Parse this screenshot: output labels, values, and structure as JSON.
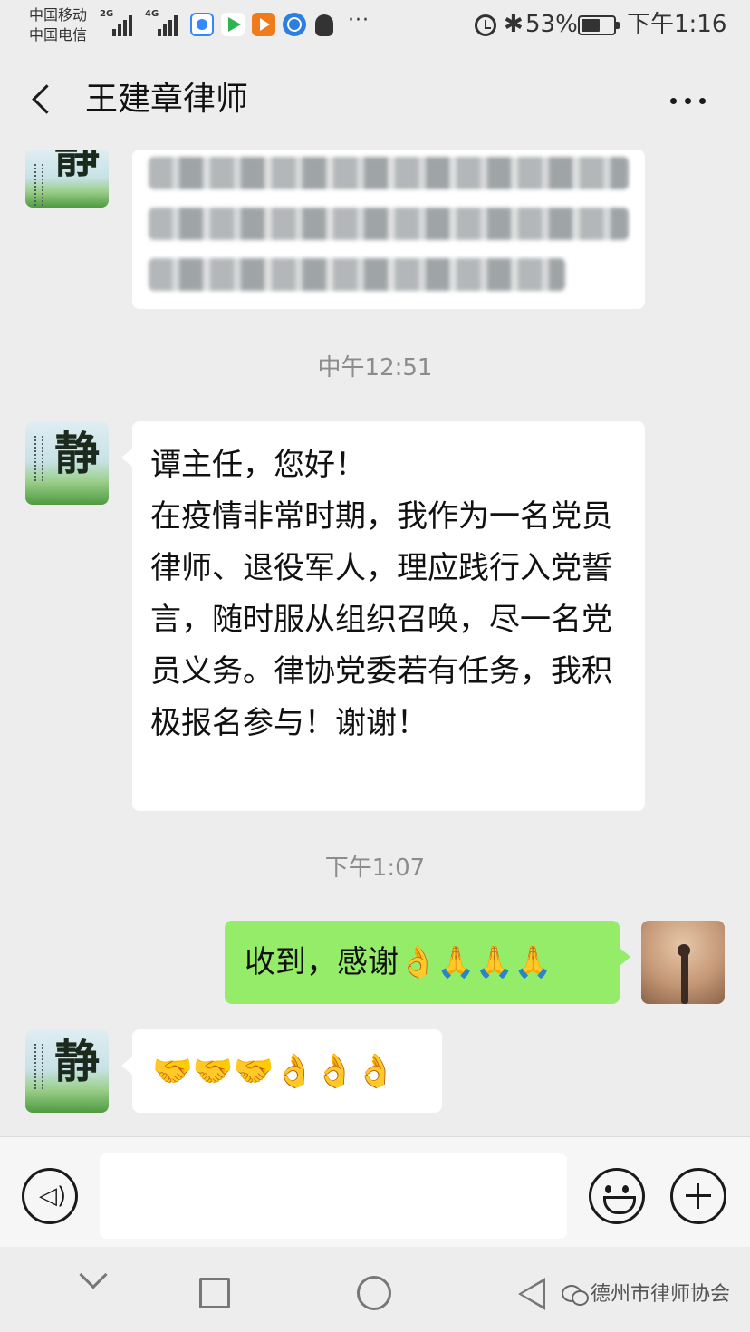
{
  "status_bar": {
    "carrier_1": "中国移动",
    "carrier_2": "中国电信",
    "net_1": "2G",
    "net_2": "4G",
    "more_dots": "···",
    "bluetooth": "✱",
    "battery": "53%",
    "battery_level": 0.53,
    "time": "下午1:16"
  },
  "header": {
    "title": "王建章律师"
  },
  "messages": [
    {
      "type": "incoming",
      "blurred": true
    },
    {
      "type": "timestamp",
      "text": "中午12:51"
    },
    {
      "type": "incoming",
      "avatar_char": "静",
      "text": "谭主任，您好！\n在疫情非常时期，我作为一名党员律师、退役军人，理应践行入党誓言，随时服从组织召唤，尽一名党员义务。律协党委若有任务，我积极报名参与！谢谢！"
    },
    {
      "type": "timestamp",
      "text": "下午1:07"
    },
    {
      "type": "outgoing",
      "text": "收到，感谢",
      "emoji": "👌🙏🙏🙏"
    },
    {
      "type": "incoming",
      "avatar_char": "静",
      "emoji": "🤝🤝🤝👌👌👌"
    }
  ],
  "input_bar": {
    "placeholder": "",
    "voice_glyph": "◁)"
  },
  "watermark": "德州市律师协会",
  "colors": {
    "background": "#ededed",
    "outgoing_bubble": "#95ec69",
    "incoming_bubble": "#ffffff",
    "timestamp": "#8c8c8c"
  }
}
